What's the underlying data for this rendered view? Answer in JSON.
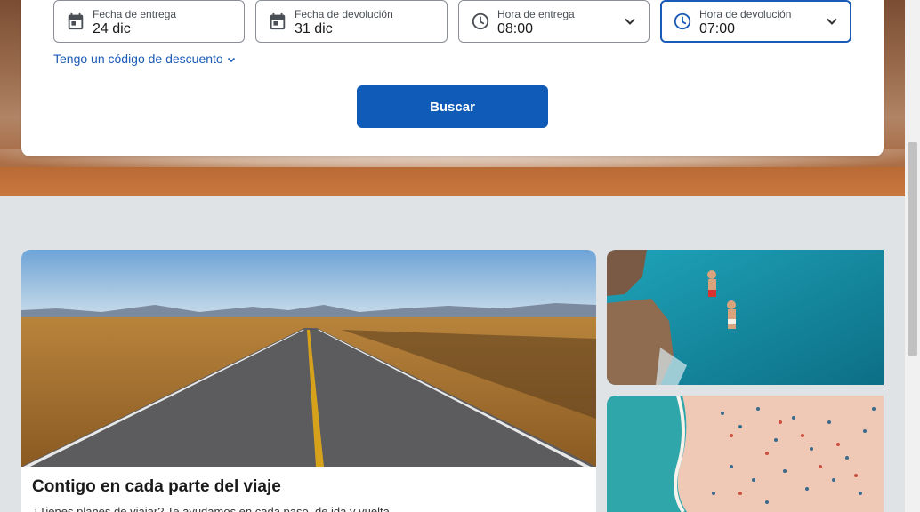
{
  "search": {
    "pickup_date": {
      "label": "Fecha de entrega",
      "value": "24 dic"
    },
    "return_date": {
      "label": "Fecha de devolución",
      "value": "31 dic"
    },
    "pickup_time": {
      "label": "Hora de entrega",
      "value": "08:00"
    },
    "return_time": {
      "label": "Hora de devolución",
      "value": "07:00"
    },
    "discount_link": "Tengo un código de descuento",
    "search_button": "Buscar"
  },
  "feature": {
    "title": "Contigo en cada parte del viaje",
    "description": "¿Tienes planes de viajar? Te ayudamos en cada paso, de ida y vuelta."
  },
  "colors": {
    "primary": "#0f5bb7",
    "link": "#1a5bb8",
    "page_bg": "#dfe3e6"
  },
  "icons": {
    "calendar": "calendar-icon",
    "clock": "clock-icon",
    "chevron": "chevron-down-icon"
  }
}
